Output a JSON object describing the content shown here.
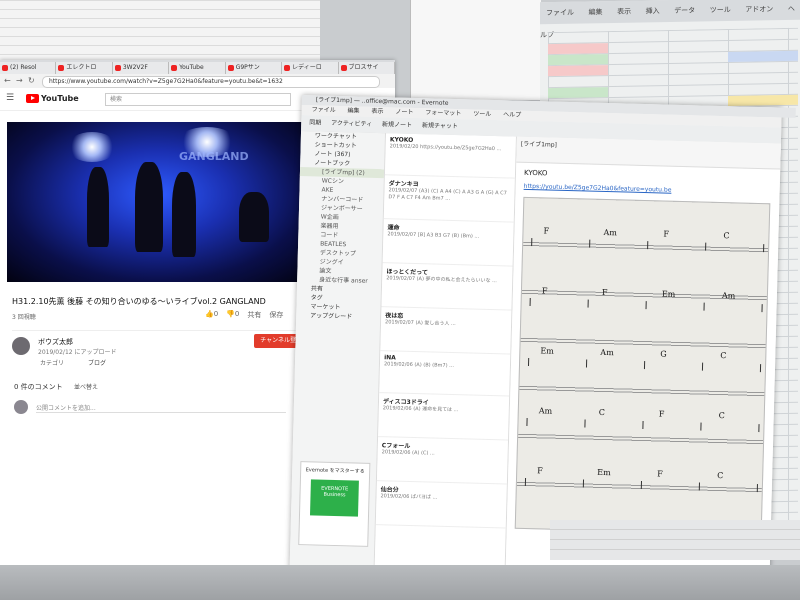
{
  "browser": {
    "tabs": [
      "(2) Resol",
      "エレクトロ",
      "3W2V2F",
      "YouTube",
      "G9Pサン",
      "レディーロ",
      "ブロスサイ",
      "YouTube"
    ],
    "url": "https://www.youtube.com/watch?v=Z5ge7G2Ha0&feature=youtu.be&t=1632",
    "youtube_logo": "YouTube",
    "search_placeholder": "検索",
    "video_title": "H31.2.10先薫 後藤 その知り合いのゆる〜いライブvol.2 GANGLAND",
    "views": "3 回視聴",
    "like_count": "0",
    "dislike_count": "0",
    "share": "共有",
    "save": "保存",
    "channel_name": "ボウズ太郎",
    "published": "2019/02/12 にアップロード",
    "subscribe": "チャンネル登録 0",
    "category_label": "カテゴリ",
    "category_value": "ブログ",
    "comments_count": "0 件のコメント",
    "sort_label": "並べ替え",
    "comment_placeholder": "公開コメントを追加..."
  },
  "evernote": {
    "window_title": "[ライブ1mp] — ..office@mac.com - Evernote",
    "menu": [
      "ファイル",
      "編集",
      "表示",
      "ノート",
      "フォーマット",
      "ツール",
      "ヘルプ"
    ],
    "toolbar": [
      "同期",
      "アクティビティ",
      "新規ノート",
      "新規チャット"
    ],
    "sidebar": [
      {
        "label": "ワークチャット",
        "hl": false,
        "sub": false
      },
      {
        "label": "ショートカット",
        "hl": false,
        "sub": false
      },
      {
        "label": "ノート (367)",
        "hl": false,
        "sub": false
      },
      {
        "label": "ノートブック",
        "hl": false,
        "sub": false
      },
      {
        "label": "[ライブmp] (2)",
        "hl": true,
        "sub": true
      },
      {
        "label": "WCシン",
        "hl": false,
        "sub": true
      },
      {
        "label": "AKE",
        "hl": false,
        "sub": true
      },
      {
        "label": "ナンバーコード",
        "hl": false,
        "sub": true
      },
      {
        "label": "ジャンボーサー",
        "hl": false,
        "sub": true
      },
      {
        "label": "W企画",
        "hl": false,
        "sub": true
      },
      {
        "label": "楽器用",
        "hl": false,
        "sub": true
      },
      {
        "label": "コード",
        "hl": false,
        "sub": true
      },
      {
        "label": "BEATLES",
        "hl": false,
        "sub": true
      },
      {
        "label": "デスクトップ",
        "hl": false,
        "sub": true
      },
      {
        "label": "ジングイ",
        "hl": false,
        "sub": true
      },
      {
        "label": "論文",
        "hl": false,
        "sub": true
      },
      {
        "label": "身近な行事 anser",
        "hl": false,
        "sub": true
      },
      {
        "label": "共有",
        "hl": false,
        "sub": false
      },
      {
        "label": "タグ",
        "hl": false,
        "sub": false
      },
      {
        "label": "マーケット",
        "hl": false,
        "sub": false
      },
      {
        "label": "アップグレード",
        "hl": false,
        "sub": false
      }
    ],
    "promo_text": "Evernote をマスターする",
    "promo_box": "EVERNOTE Business",
    "notes": [
      {
        "title": "KYOKO",
        "body": "2019/02/20 https://youtu.be/Z5ge7G2Ha0 ..."
      },
      {
        "title": "ダナンキヨ",
        "body": "2019/02/07 (A3) (C) A A4 (C) A A3 G A (G) A C7 D7 F A C7 F4 Am Bm7 ..."
      },
      {
        "title": "運命",
        "body": "2019/02/07 [B] A3 B3 G7 (B) (Bm) ..."
      },
      {
        "title": "ほっとくだって",
        "body": "2019/02/07 (A) 夢の中の私と会えたらいいな ..."
      },
      {
        "title": "夜は恋",
        "body": "2019/02/07 (A) 愛し合う人 ..."
      },
      {
        "title": "iNA",
        "body": "2019/02/06 (A) (B) (Bm7) ..."
      },
      {
        "title": "ディスコ3ドライ",
        "body": "2019/02/06 (A) 運命を見ては ..."
      },
      {
        "title": "Cフォール",
        "body": "2019/02/06 (A) (C) ..."
      },
      {
        "title": "仙台分",
        "body": "2019/02/06 ぱパヨぱ ..."
      }
    ],
    "editor_notebook": "[ライブ1mp]",
    "editor_title": "KYOKO",
    "editor_link": "https://youtu.be/Z5ge7G2Ha0&feature=youtu.be",
    "chords": [
      "F",
      "Am",
      "F",
      "C",
      "F",
      "F",
      "Em",
      "Am",
      "Em",
      "Am",
      "G",
      "C",
      "Am",
      "C",
      "F",
      "C",
      "F",
      "Em",
      "F",
      "C"
    ]
  },
  "spreadsheet": {
    "menu": [
      "ファイル",
      "編集",
      "表示",
      "挿入",
      "データ",
      "ツール",
      "アドオン",
      "ヘルプ"
    ]
  },
  "colors": {
    "subscribe": "#e23c2b",
    "youtube_red": "#ff0000",
    "evernote_green": "#2db04a"
  }
}
